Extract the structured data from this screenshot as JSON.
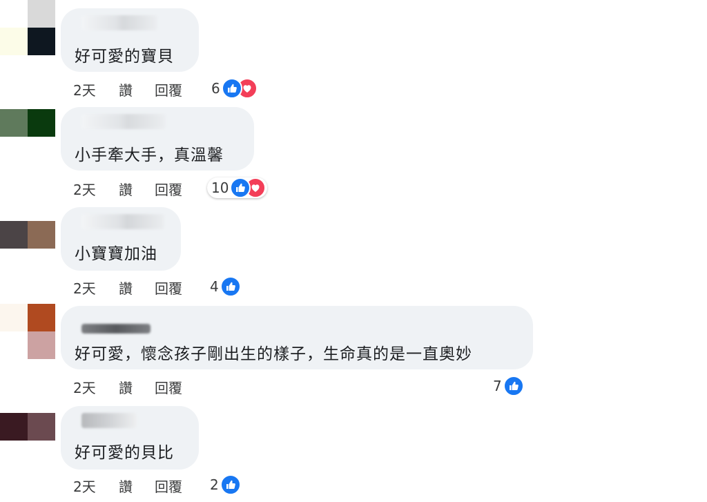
{
  "colors": {
    "bubble": "#eff2f5",
    "like": "#1877f2",
    "love": "#f33e58",
    "text": "#1c1e21",
    "meta": "#3a3b3c"
  },
  "comments": [
    {
      "text": "好可愛的寶貝",
      "time": "2天",
      "like_label": "讚",
      "reply_label": "回覆",
      "reaction_count": "6",
      "reactions": [
        "like-icon",
        "love-icon"
      ],
      "avatar_colors": [
        "#d9d9d9",
        "#ffffff",
        "#fcfce8",
        "#0e1720"
      ]
    },
    {
      "text": "小手牽大手，真溫馨",
      "time": "2天",
      "like_label": "讚",
      "reply_label": "回覆",
      "reaction_count": "10",
      "reactions": [
        "like-icon",
        "love-icon"
      ],
      "avatar_colors": [
        "#5f7a5c",
        "#0a3a0e"
      ]
    },
    {
      "text": "小寶寶加油",
      "time": "2天",
      "like_label": "讚",
      "reply_label": "回覆",
      "reaction_count": "4",
      "reactions": [
        "like-icon"
      ],
      "avatar_colors": [
        "#4b4446",
        "#8b6a55"
      ]
    },
    {
      "text": "好可愛，懷念孩子剛出生的樣子，生命真的是一直奧妙",
      "time": "2天",
      "like_label": "讚",
      "reply_label": "回覆",
      "reaction_count": "7",
      "reactions": [
        "like-icon"
      ],
      "avatar_colors": [
        "#fcf6ee",
        "#b04a20",
        "#ffffff",
        "#cca2a2"
      ]
    },
    {
      "text": "好可愛的貝比",
      "time": "2天",
      "like_label": "讚",
      "reply_label": "回覆",
      "reaction_count": "2",
      "reactions": [
        "like-icon"
      ],
      "avatar_colors": [
        "#3a1a22",
        "#6b4a50"
      ]
    }
  ]
}
